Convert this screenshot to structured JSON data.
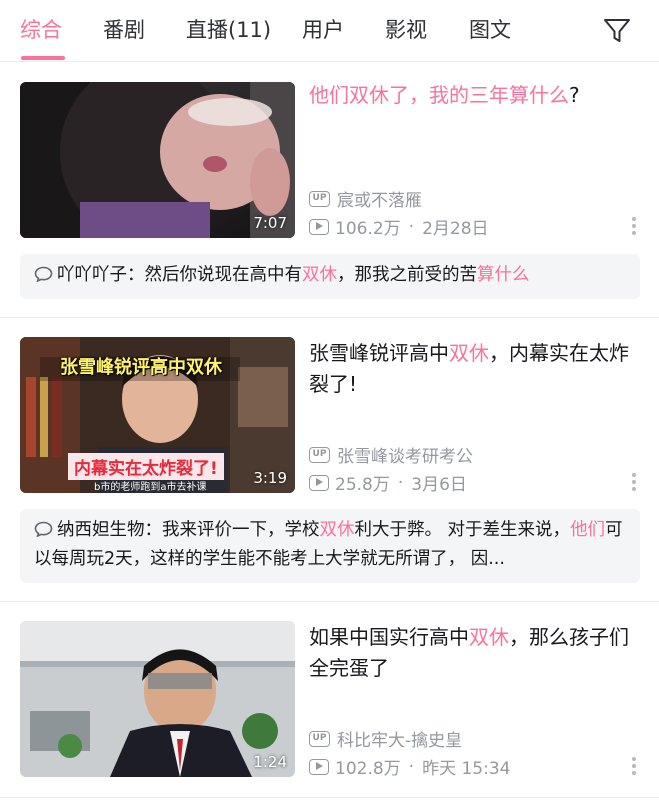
{
  "tabs": [
    {
      "label": "综合",
      "active": true
    },
    {
      "label": "番剧"
    },
    {
      "label": "直播(11)"
    },
    {
      "label": "用户"
    },
    {
      "label": "影视"
    },
    {
      "label": "图文"
    }
  ],
  "filter_icon": "filter-icon",
  "accent_color": "#fb7299",
  "videos": [
    {
      "title_parts": [
        "他们",
        "双休",
        "了，",
        "我的三年算什么",
        "?"
      ],
      "title_highlight": [
        true,
        true,
        true,
        true,
        false
      ],
      "duration": "7:07",
      "uploader": "宸或不落雁",
      "views": "106.2万",
      "date": "2月28日",
      "comment": {
        "author": "吖吖吖子：",
        "parts": [
          "然后你说现在高中有",
          "双休",
          "，那我之前受的苦",
          "算什么"
        ],
        "highlight": [
          false,
          true,
          false,
          true
        ]
      }
    },
    {
      "title_parts": [
        "张雪峰锐评高中",
        "双休",
        "，内幕实在太炸裂了!"
      ],
      "title_highlight": [
        false,
        true,
        false
      ],
      "duration": "3:19",
      "thumb_caption_top": "张雪峰锐评高中双休",
      "thumb_caption_bottom": "内幕实在太炸裂了!",
      "thumb_subtitle": "b市的老师跑到a市去补课",
      "uploader": "张雪峰谈考研考公",
      "views": "25.8万",
      "date": "3月6日",
      "comment": {
        "author": "纳西妲生物：",
        "parts": [
          "我来评价一下，学校",
          "双休",
          "利大于弊。 对于差生来说，",
          "他们",
          "可以每周玩2天，这样的学生能不能考上大学就无所谓了， 因..."
        ],
        "highlight": [
          false,
          true,
          false,
          true,
          false
        ]
      }
    },
    {
      "title_parts": [
        "如果中国实行高中",
        "双休",
        "，那么孩子们全完蛋了"
      ],
      "title_highlight": [
        false,
        true,
        false
      ],
      "duration": "1:24",
      "uploader": "科比牢大-擒史皇",
      "views": "102.8万",
      "date": "昨天 15:34"
    }
  ],
  "badges": {
    "uploader": "UP"
  }
}
